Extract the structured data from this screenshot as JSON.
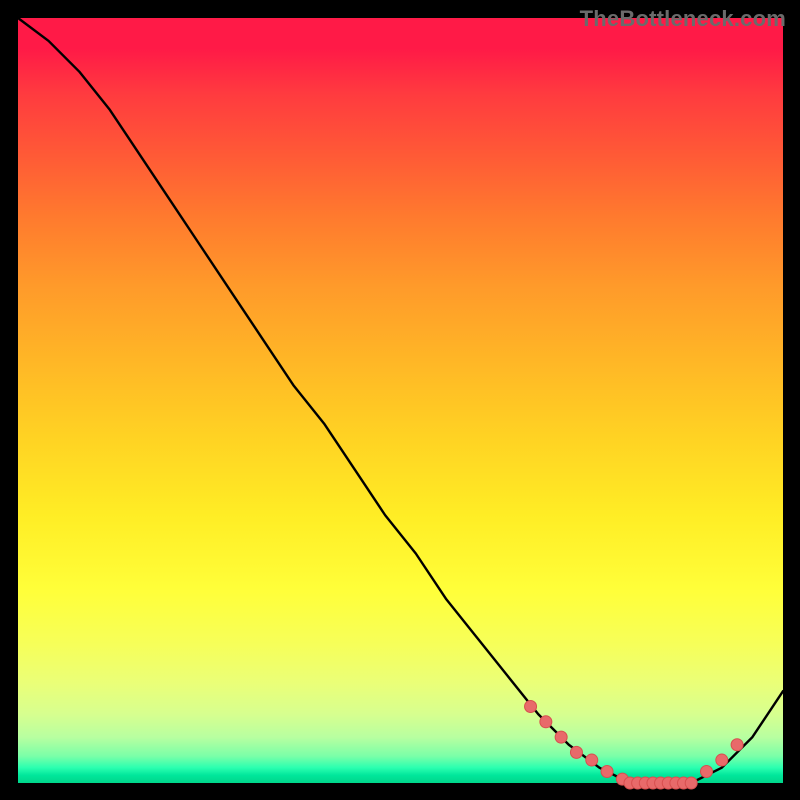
{
  "watermark": {
    "text": "TheBottleneck.com"
  },
  "colors": {
    "curve_stroke": "#000000",
    "marker_fill": "#e86a6a",
    "marker_stroke": "#d84f4f",
    "background_top": "#ff1a47",
    "background_bottom": "#00d68a",
    "page_bg": "#000000"
  },
  "chart_data": {
    "type": "line",
    "title": "",
    "xlabel": "",
    "ylabel": "",
    "xlim": [
      0,
      100
    ],
    "ylim": [
      0,
      100
    ],
    "grid": false,
    "legend": false,
    "series": [
      {
        "name": "bottleneck-curve",
        "x": [
          0,
          4,
          8,
          12,
          16,
          20,
          24,
          28,
          32,
          36,
          40,
          44,
          48,
          52,
          56,
          60,
          64,
          68,
          72,
          76,
          80,
          84,
          88,
          92,
          96,
          100
        ],
        "y": [
          100,
          97,
          93,
          88,
          82,
          76,
          70,
          64,
          58,
          52,
          47,
          41,
          35,
          30,
          24,
          19,
          14,
          9,
          5,
          2,
          0,
          0,
          0,
          2,
          6,
          12
        ]
      }
    ],
    "markers": {
      "name": "highlight-points",
      "x": [
        67,
        69,
        71,
        73,
        75,
        77,
        79,
        80,
        81,
        82,
        83,
        84,
        85,
        86,
        87,
        88,
        90,
        92,
        94
      ],
      "y": [
        10,
        8,
        6,
        4,
        3,
        1.5,
        0.5,
        0,
        0,
        0,
        0,
        0,
        0,
        0,
        0,
        0,
        1.5,
        3,
        5
      ]
    }
  }
}
